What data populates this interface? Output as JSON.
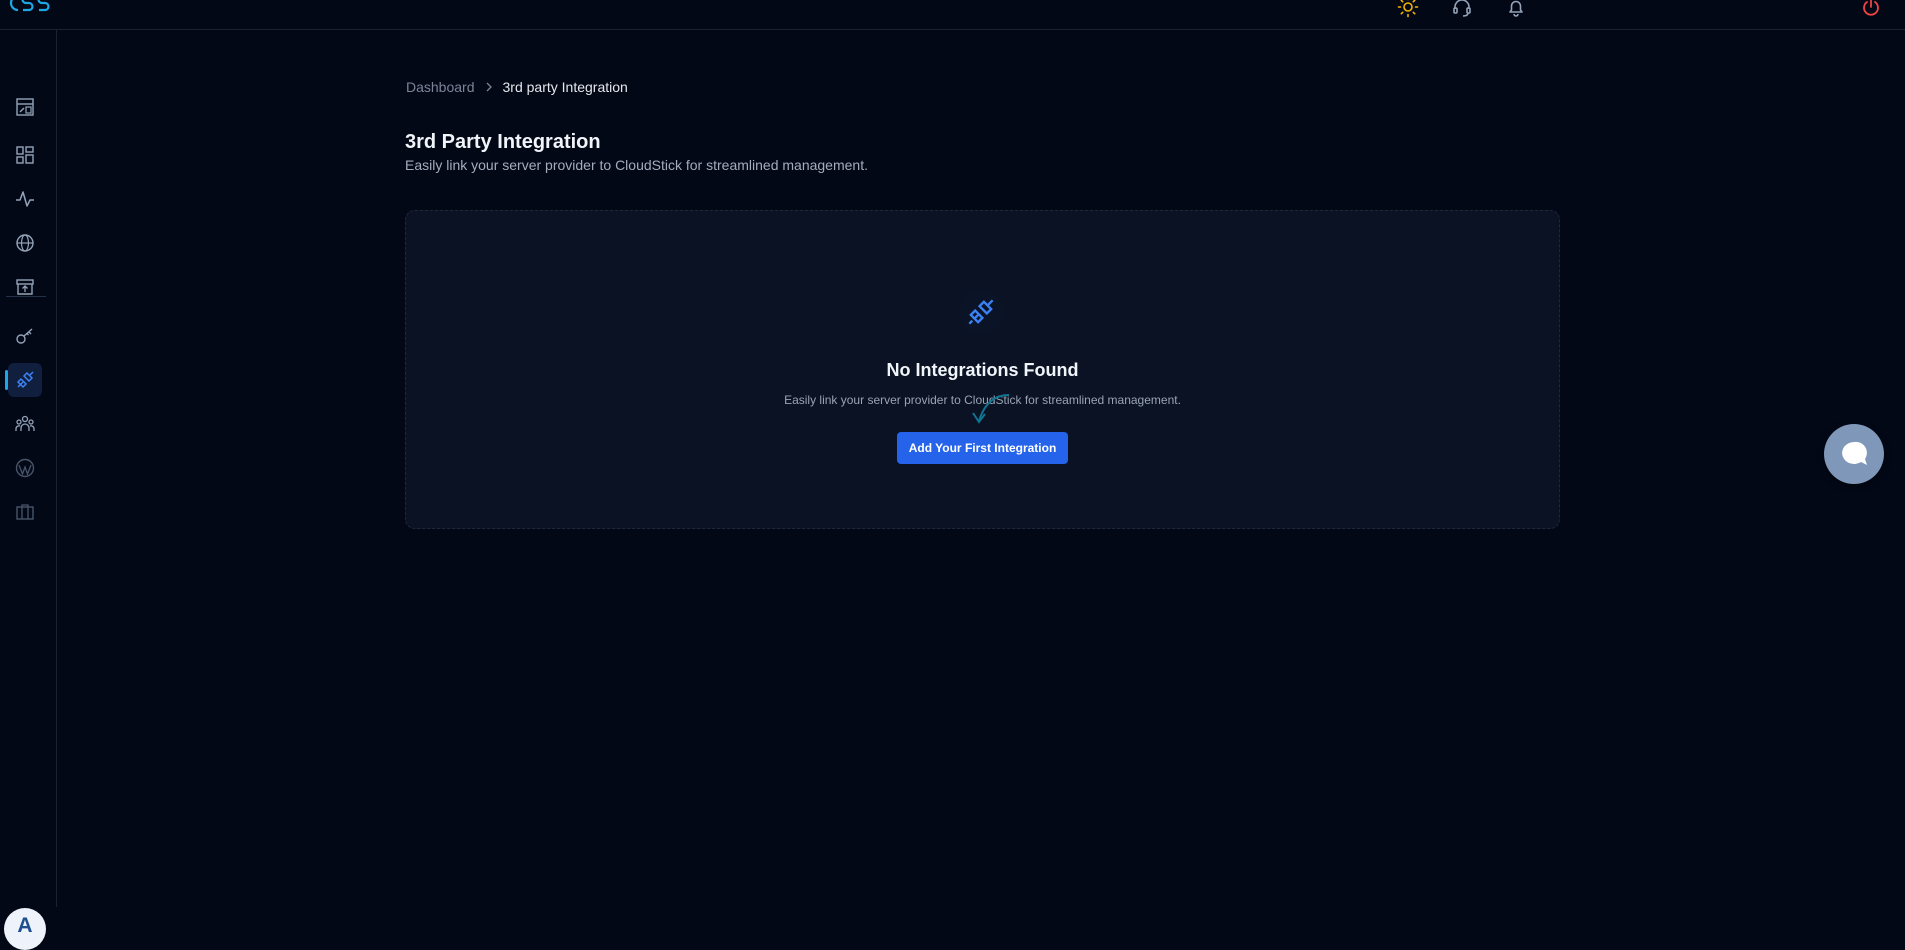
{
  "breadcrumb": {
    "home": "Dashboard",
    "current": "3rd party Integration"
  },
  "page": {
    "title": "3rd Party Integration",
    "subtitle": "Easily link your server provider to CloudStick for streamlined management."
  },
  "empty_state": {
    "icon": "plug-icon",
    "title": "No Integrations Found",
    "description": "Easily link your server provider to CloudStick for streamlined management.",
    "button_label": "Add Your First Integration"
  },
  "user": {
    "avatar_initial": "A"
  },
  "sidebar": {
    "items": [
      {
        "icon": "report-icon"
      },
      {
        "icon": "dashboard-grid-icon"
      },
      {
        "icon": "activity-icon"
      },
      {
        "icon": "globe-icon"
      },
      {
        "icon": "archive-upload-icon"
      },
      {
        "icon": "key-icon"
      },
      {
        "icon": "plug-icon",
        "active": true
      },
      {
        "icon": "team-icon"
      },
      {
        "icon": "wordpress-icon"
      },
      {
        "icon": "briefcase-icon"
      }
    ]
  },
  "header": {
    "icons": [
      "theme-sun-icon",
      "support-headset-icon",
      "bell-icon",
      "power-icon"
    ]
  },
  "colors": {
    "background": "#030817",
    "card": "#0a1223",
    "accent": "#2563eb",
    "active_indicator": "#1ea7e4",
    "sun": "#f5b301",
    "power": "#ef4444"
  }
}
